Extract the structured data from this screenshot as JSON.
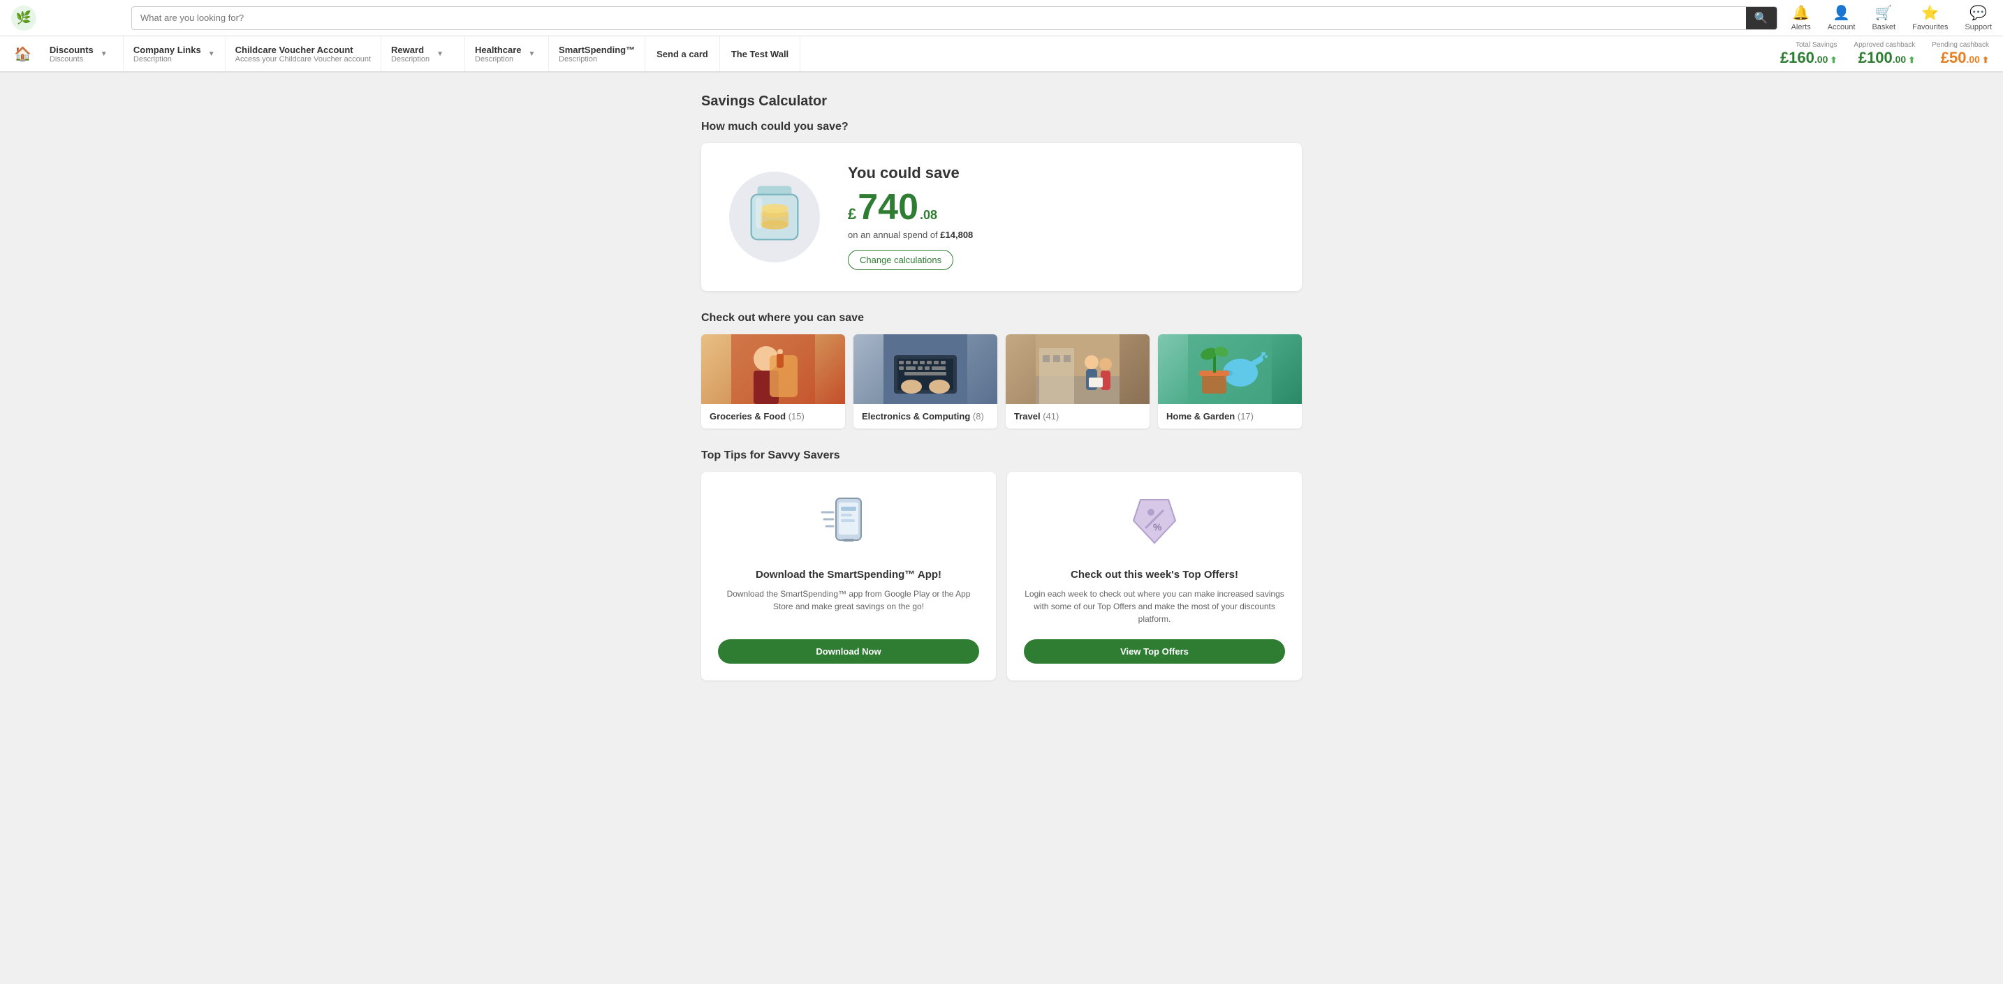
{
  "topNav": {
    "search_placeholder": "What are you looking for?",
    "actions": [
      {
        "id": "alerts",
        "label": "Alerts",
        "icon": "🔔"
      },
      {
        "id": "account",
        "label": "Account",
        "icon": "👤"
      },
      {
        "id": "basket",
        "label": "Basket",
        "icon": "🛒"
      },
      {
        "id": "favourites",
        "label": "Favourites",
        "icon": "⭐"
      },
      {
        "id": "support",
        "label": "Support",
        "icon": "💬"
      }
    ]
  },
  "mainNav": {
    "items": [
      {
        "id": "discounts",
        "title": "Discounts",
        "desc": "Discounts",
        "hasChevron": true
      },
      {
        "id": "company-links",
        "title": "Company Links",
        "desc": "Description",
        "hasChevron": true
      },
      {
        "id": "childcare",
        "title": "Childcare Voucher Account",
        "desc": "Access your Childcare Voucher account",
        "hasChevron": false
      },
      {
        "id": "reward",
        "title": "Reward",
        "desc": "Description",
        "hasChevron": true
      },
      {
        "id": "healthcare",
        "title": "Healthcare",
        "desc": "Description",
        "hasChevron": true
      },
      {
        "id": "smartspending",
        "title": "SmartSpending™",
        "desc": "Description",
        "hasChevron": false
      },
      {
        "id": "send-card",
        "title": "Send a card",
        "hasChevron": false
      },
      {
        "id": "test-wall",
        "title": "The Test Wall",
        "hasChevron": false
      }
    ]
  },
  "savingsSummary": {
    "total_label": "Total Savings",
    "total_amount": "£160",
    "total_decimal": ".00",
    "approved_label": "Approved cashback",
    "approved_amount": "£100",
    "approved_decimal": ".00",
    "pending_label": "Pending cashback",
    "pending_amount": "£50",
    "pending_decimal": ".00"
  },
  "calculator": {
    "page_title": "Savings Calculator",
    "section_title": "How much could you save?",
    "you_could_save": "You could save",
    "pound_sym": "£",
    "big_number": "740",
    "decimal": ".08",
    "on_spend_text": "on an annual spend of ",
    "spend_amount": "£14,808",
    "change_calc_label": "Change calculations"
  },
  "categories": {
    "section_title": "Check out where you can save",
    "items": [
      {
        "id": "groceries",
        "label": "Groceries & Food",
        "count": "(15)",
        "emoji": "🛒"
      },
      {
        "id": "electronics",
        "label": "Electronics & Computing",
        "count": "(8)",
        "emoji": "💻"
      },
      {
        "id": "travel",
        "label": "Travel",
        "count": "(41)",
        "emoji": "✈️"
      },
      {
        "id": "home-garden",
        "label": "Home & Garden",
        "count": "(17)",
        "emoji": "🪴"
      }
    ]
  },
  "tips": {
    "section_title": "Top Tips for Savvy Savers",
    "items": [
      {
        "id": "app",
        "icon": "📱",
        "title": "Download the SmartSpending™ App!",
        "desc": "Download the SmartSpending™ app from Google Play or the App Store and make great savings on the go!",
        "btn_label": "Download Now"
      },
      {
        "id": "top-offers",
        "icon": "🏷️",
        "title": "Check out this week's Top Offers!",
        "desc": "Login each week to check out where you can make increased savings with some of our Top Offers and make the most of your discounts platform.",
        "btn_label": "View Top Offers"
      }
    ]
  }
}
